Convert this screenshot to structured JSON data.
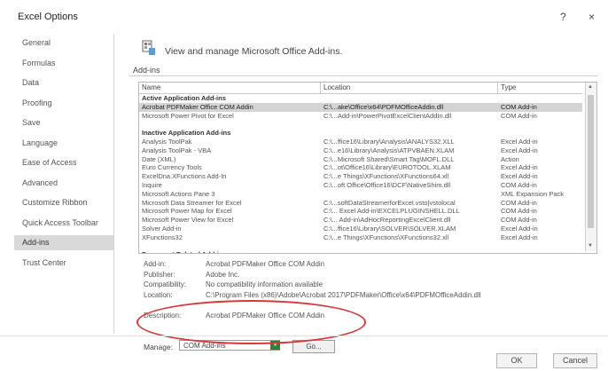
{
  "window": {
    "title": "Excel Options",
    "help": "?",
    "close": "×"
  },
  "sidebar": {
    "items": [
      {
        "label": "General"
      },
      {
        "label": "Formulas"
      },
      {
        "label": "Data"
      },
      {
        "label": "Proofing"
      },
      {
        "label": "Save"
      },
      {
        "label": "Language"
      },
      {
        "label": "Ease of Access"
      },
      {
        "label": "Advanced"
      },
      {
        "label": "Customize Ribbon"
      },
      {
        "label": "Quick Access Toolbar"
      },
      {
        "label": "Add-ins",
        "active": true
      },
      {
        "label": "Trust Center"
      }
    ]
  },
  "main": {
    "header": "View and manage Microsoft Office Add-ins.",
    "section": "Add-ins",
    "columns": [
      "Name",
      "Location",
      "Type"
    ],
    "rows": [
      {
        "kind": "group",
        "name": "Active Application Add-ins",
        "location": "",
        "type": ""
      },
      {
        "kind": "selected",
        "name": "Acrobat PDFMaker Office COM Addin",
        "location": "C:\\...ake\\Office\\x64\\PDFMOfficeAddin.dll",
        "type": "COM Add-in"
      },
      {
        "kind": "row",
        "name": "Microsoft Power Pivot for Excel",
        "location": "C:\\...Add-in\\PowerPivotExcelClientAddIn.dll",
        "type": "COM Add-in"
      },
      {
        "kind": "blank",
        "name": "",
        "location": "",
        "type": ""
      },
      {
        "kind": "group",
        "name": "Inactive Application Add-ins",
        "location": "",
        "type": ""
      },
      {
        "kind": "row",
        "name": "Analysis ToolPak",
        "location": "C:\\...ffice16\\Library\\Analysis\\ANALYS32.XLL",
        "type": "Excel Add-in"
      },
      {
        "kind": "row",
        "name": "Analysis ToolPak - VBA",
        "location": "C:\\...e16\\Library\\Analysis\\ATPVBAEN.XLAM",
        "type": "Excel Add-in"
      },
      {
        "kind": "row",
        "name": "Date (XML)",
        "location": "C:\\...Microsoft Shared\\Smart Tag\\MOFL.DLL",
        "type": "Action"
      },
      {
        "kind": "row",
        "name": "Euro Currency Tools",
        "location": "C:\\...ot\\Office16\\Library\\EUROTOOL.XLAM",
        "type": "Excel Add-in"
      },
      {
        "kind": "row",
        "name": "ExcelDna.XFunctions Add-In",
        "location": "C:\\...e Things\\XFunctions\\XFunctions64.xll",
        "type": "Excel Add-in"
      },
      {
        "kind": "row",
        "name": "Inquire",
        "location": "C:\\...oft Office\\Office16\\DCF\\NativeShim.dll",
        "type": "COM Add-in"
      },
      {
        "kind": "row",
        "name": "Microsoft Actions Pane 3",
        "location": "",
        "type": "XML Expansion Pack"
      },
      {
        "kind": "row",
        "name": "Microsoft Data Streamer for Excel",
        "location": "C:\\...softDataStreamerforExcel.vsto|vstolocal",
        "type": "COM Add-in"
      },
      {
        "kind": "row",
        "name": "Microsoft Power Map for Excel",
        "location": "C:\\... Excel Add-in\\EXCELPLUGINSHELL.DLL",
        "type": "COM Add-in"
      },
      {
        "kind": "row",
        "name": "Microsoft Power View for Excel",
        "location": "C:\\... Add-in\\AdHocReportingExcelClient.dll",
        "type": "COM Add-in"
      },
      {
        "kind": "row",
        "name": "Solver Add-in",
        "location": "C:\\...ffice16\\Library\\SOLVER\\SOLVER.XLAM",
        "type": "Excel Add-in"
      },
      {
        "kind": "row",
        "name": "XFunctions32",
        "location": "C:\\...e Things\\XFunctions\\XFunctions32.xll",
        "type": "Excel Add-in"
      },
      {
        "kind": "blank",
        "name": "",
        "location": "",
        "type": ""
      },
      {
        "kind": "group",
        "name": "Document Related Add-ins",
        "location": "",
        "type": ""
      }
    ],
    "details": [
      {
        "label": "Add-in:",
        "value": "Acrobat PDFMaker Office COM Addin"
      },
      {
        "label": "Publisher:",
        "value": "Adobe Inc."
      },
      {
        "label": "Compatibility:",
        "value": "No compatibility information available"
      },
      {
        "label": "Location:",
        "value": "C:\\Program Files (x86)\\Adobe\\Acrobat 2017\\PDFMaker\\Office\\x64\\PDFMOfficeAddin.dll"
      },
      {
        "label": "",
        "value": ""
      },
      {
        "label": "Description:",
        "value": "Acrobat PDFMaker Office COM Addin"
      }
    ],
    "manage_label": "Manage:",
    "manage_value": "COM Add-ins",
    "go_label": "Go..."
  },
  "footer": {
    "ok": "OK",
    "cancel": "Cancel"
  },
  "colors": {
    "highlight": "#d43a3a",
    "active_item": "#d9d9d9",
    "dropdown_arrow": "#3a7c3a"
  }
}
